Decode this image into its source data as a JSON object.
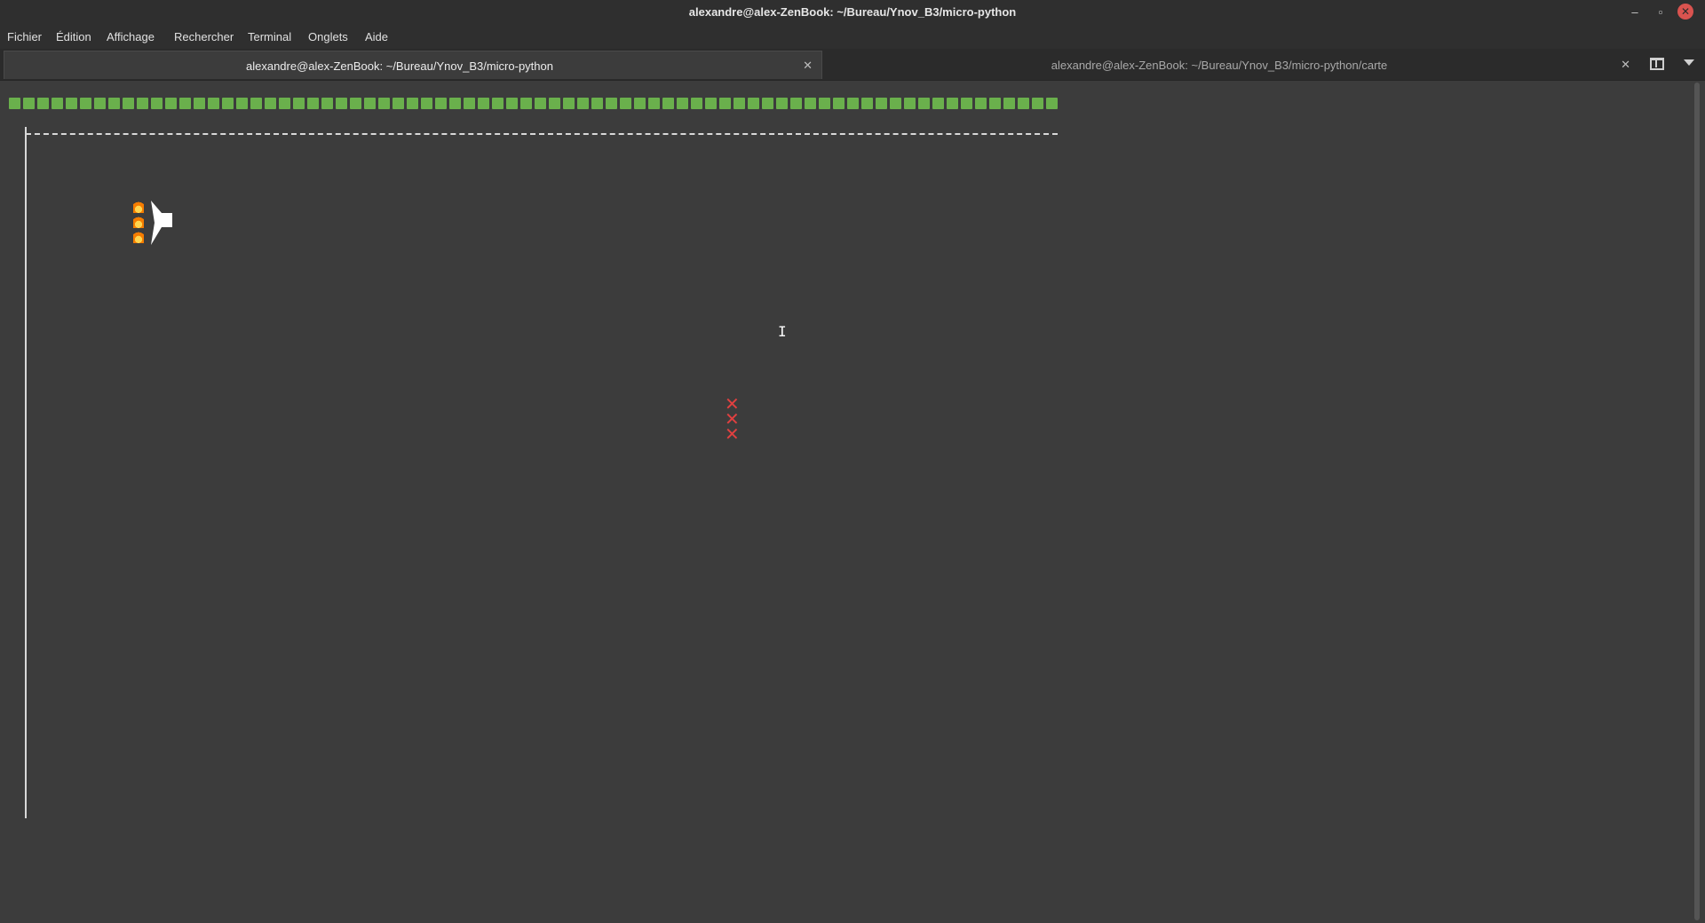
{
  "window": {
    "title": "alexandre@alex-ZenBook: ~/Bureau/Ynov_B3/micro-python",
    "controls": {
      "minimize": "–",
      "maximize": "▫",
      "close": "✕"
    }
  },
  "menubar": {
    "items": [
      "Fichier",
      "Édition",
      "Affichage",
      "Rechercher",
      "Terminal",
      "Onglets",
      "Aide"
    ]
  },
  "tabs": [
    {
      "title": "alexandre@alex-ZenBook: ~/Bureau/Ynov_B3/micro-python",
      "active": true,
      "close": "✕"
    },
    {
      "title": "alexandre@alex-ZenBook: ~/Bureau/Ynov_B3/micro-python/carte",
      "active": false,
      "close": "✕"
    }
  ],
  "game": {
    "health_blocks_count": 74,
    "health_block_color": "#6ab04c",
    "player_icon": "ship-icon",
    "thruster_icon": "fire-icon",
    "thruster_count": 3,
    "enemy_icon": "cross-mark-icon",
    "enemy_color": "#e04040",
    "enemy_marks": [
      "✕",
      "✕",
      "✕"
    ]
  },
  "colors": {
    "background": "#3c3c3c",
    "titlebar": "#2f2f2f",
    "close_button": "#d9534f"
  }
}
